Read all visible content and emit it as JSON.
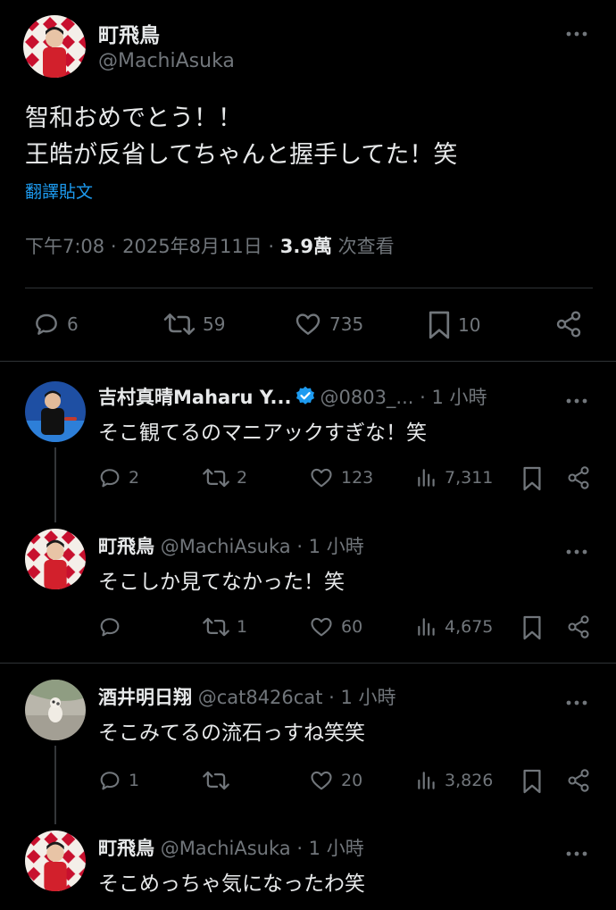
{
  "main_post": {
    "name": "町飛鳥",
    "handle": "@MachiAsuka",
    "text_line1": "智和おめでとう！！",
    "text_line2": "王皓が反省してちゃんと握手してた！笑",
    "translate": "翻譯貼文",
    "time": "下午7:08 · 2025年8月11日 · ",
    "views_count": "3.9萬",
    "views_label": " 次查看",
    "replies": "6",
    "reposts": "59",
    "likes": "735",
    "bookmarks": "10"
  },
  "replies": [
    {
      "name": "吉村真晴Maharu Y...",
      "handle": "@0803_...",
      "time": " · 1 小時",
      "verified": true,
      "text": "そこ観てるのマニアックすぎな！笑",
      "replies": "2",
      "reposts": "2",
      "likes": "123",
      "views": "7,311"
    },
    {
      "name": "町飛鳥",
      "handle": "@MachiAsuka",
      "time": " · 1 小時",
      "text": "そこしか見てなかった！笑",
      "replies": "",
      "reposts": "1",
      "likes": "60",
      "views": "4,675"
    },
    {
      "name": "酒井明日翔",
      "handle": "@cat8426cat",
      "time": " · 1 小時",
      "text": "そこみてるの流石っすね笑笑",
      "replies": "1",
      "reposts": "",
      "likes": "20",
      "views": "3,826"
    },
    {
      "name": "町飛鳥",
      "handle": "@MachiAsuka",
      "time": " · 1 小時",
      "text": "そこめっちゃ気になったわ笑"
    }
  ],
  "colors": {
    "background": "#000000",
    "text": "#e7e9ea",
    "secondary": "#71767b",
    "link": "#1d9bf0",
    "verified": "#1d9bf0",
    "divider": "#2f3336"
  },
  "icons": [
    "more-icon",
    "reply-icon",
    "repost-icon",
    "like-icon",
    "bookmark-icon",
    "share-icon",
    "views-icon",
    "verified-icon"
  ]
}
